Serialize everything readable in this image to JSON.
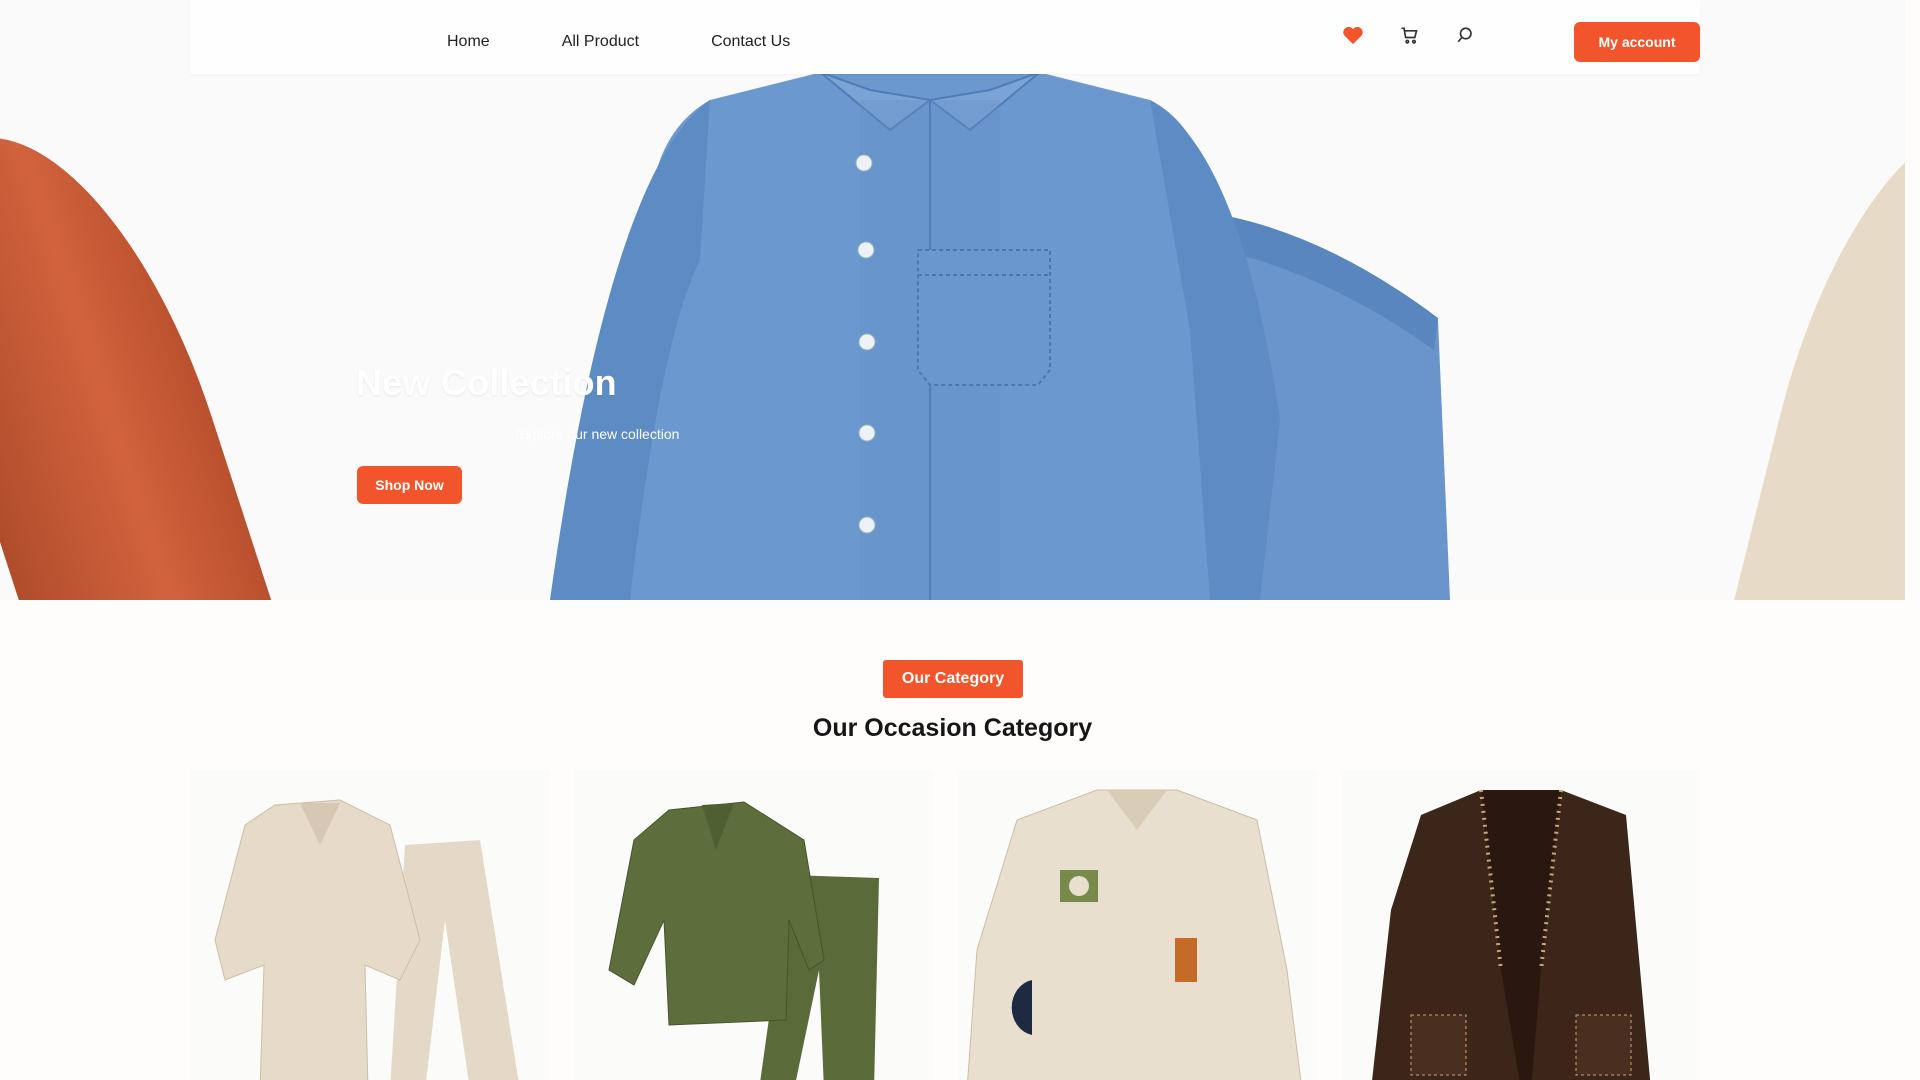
{
  "nav": {
    "links": [
      "Home",
      "All Product",
      "Contact Us"
    ],
    "account_label": "My account",
    "icons": [
      "heart-icon",
      "cart-icon",
      "search-icon"
    ]
  },
  "hero": {
    "title": "New Collection",
    "subtitle": "Explore our new collection",
    "cta_label": "Shop Now"
  },
  "category": {
    "badge": "Our Category",
    "title": "Our Occasion Category",
    "cards": [
      "beige-co-ord-set",
      "olive-co-ord-set",
      "patchwork-shirt",
      "embellished-jacket"
    ]
  },
  "colors": {
    "accent": "#f2552c",
    "denim": "#5e8ec7",
    "olive": "#5b6b3a",
    "beige": "#e2d5c2",
    "brown": "#3b2418"
  }
}
